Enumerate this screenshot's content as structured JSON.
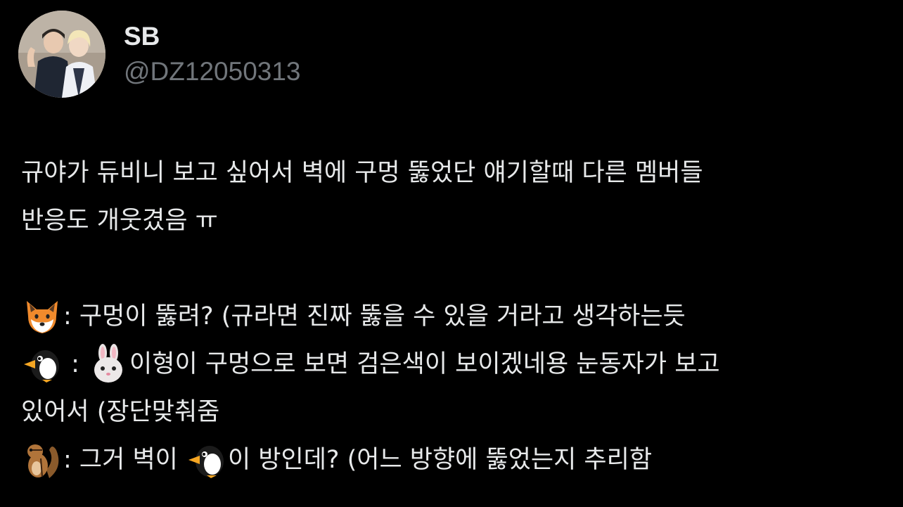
{
  "author": {
    "display_name": "SB",
    "handle": "@DZ12050313"
  },
  "tweet": {
    "line1": "규야가 듀비니 보고 싶어서 벽에 구멍 뚫었단 얘기할때 다른 멤버들",
    "line2": "반응도 개웃겼음 ㅠ",
    "line3_text": ": 구멍이 뚫려? (규라면 진짜 뚫을 수 있을 거라고 생각하는듯",
    "line4_sep": " : ",
    "line4_text": "이형이 구멍으로 보면 검은색이 보이겠네용 눈동자가 보고",
    "line5": "있어서 (장단맞춰줌",
    "line6_a": ": 그거 벽이 ",
    "line6_b": "이 방인데? (어느 방향에 뚫었는지 추리함"
  },
  "emoji": {
    "line3": "fox-emoji",
    "line4_a": "penguin-emoji",
    "line4_b": "rabbit-emoji",
    "line6_a": "chipmunk-emoji",
    "line6_b": "penguin-emoji"
  },
  "colors": {
    "background": "#000000",
    "text": "#e7e9ea",
    "handle": "#71767b"
  }
}
